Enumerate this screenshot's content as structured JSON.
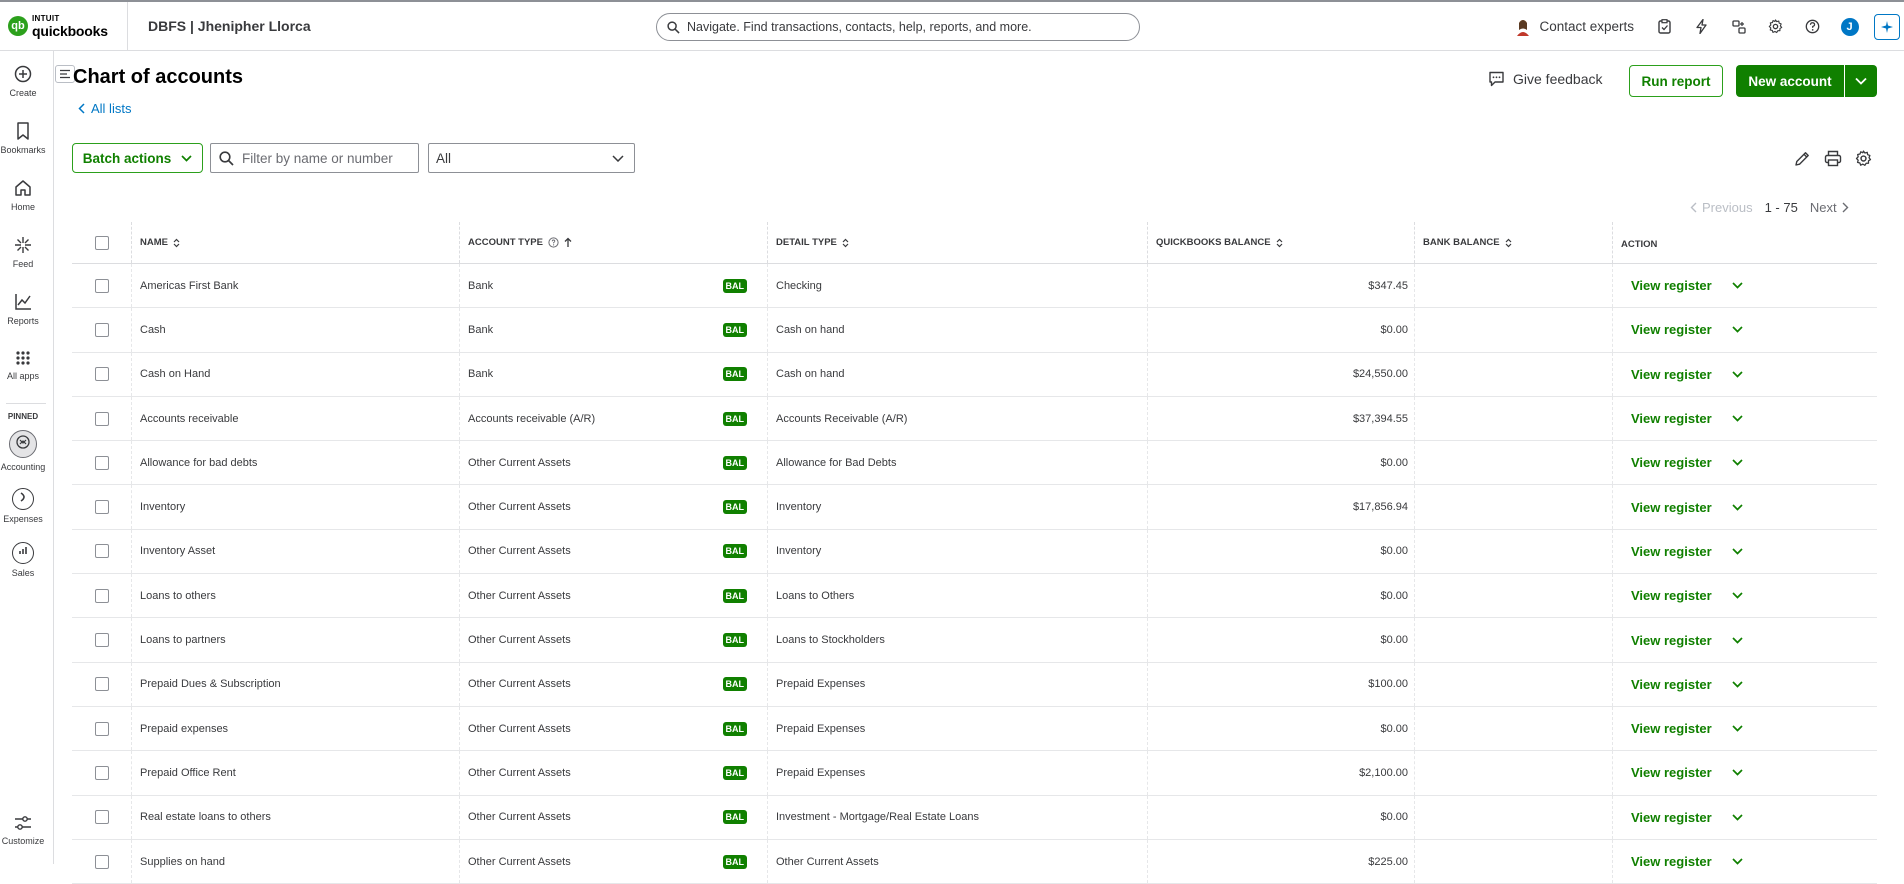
{
  "header": {
    "logo_intuit": "INTUIT",
    "logo_brand": "quickbooks",
    "company": "DBFS | Jhenipher Llorca",
    "search_placeholder": "Navigate. Find transactions, contacts, help, reports, and more.",
    "contact_experts": "Contact experts",
    "user_initial": "J"
  },
  "rail": {
    "create": "Create",
    "bookmarks": "Bookmarks",
    "home": "Home",
    "feed": "Feed",
    "reports": "Reports",
    "all_apps": "All apps",
    "pinned": "PINNED",
    "accounting": "Accounting",
    "expenses": "Expenses",
    "sales": "Sales",
    "customize": "Customize"
  },
  "page": {
    "title": "Chart of accounts",
    "back_link": "All lists",
    "give_feedback": "Give feedback",
    "run_report": "Run report",
    "new_account": "New account",
    "batch_actions": "Batch actions",
    "filter_placeholder": "Filter by name or number",
    "type_filter": "All",
    "pager_prev": "Previous",
    "pager_range": "1 - 75",
    "pager_next": "Next"
  },
  "table": {
    "headers": {
      "name": "NAME",
      "account_type": "ACCOUNT TYPE",
      "detail_type": "DETAIL TYPE",
      "qb_balance": "QUICKBOOKS BALANCE",
      "bank_balance": "BANK BALANCE",
      "action": "ACTION"
    },
    "badge": "BAL",
    "action_label": "View register",
    "rows": [
      {
        "name": "Americas First Bank",
        "type": "Bank",
        "detail": "Checking",
        "balance": "$347.45",
        "bank": ""
      },
      {
        "name": "Cash",
        "type": "Bank",
        "detail": "Cash on hand",
        "balance": "$0.00",
        "bank": ""
      },
      {
        "name": "Cash on Hand",
        "type": "Bank",
        "detail": "Cash on hand",
        "balance": "$24,550.00",
        "bank": ""
      },
      {
        "name": "Accounts receivable",
        "type": "Accounts receivable (A/R)",
        "detail": "Accounts Receivable (A/R)",
        "balance": "$37,394.55",
        "bank": ""
      },
      {
        "name": "Allowance for bad debts",
        "type": "Other Current Assets",
        "detail": "Allowance for Bad Debts",
        "balance": "$0.00",
        "bank": ""
      },
      {
        "name": "Inventory",
        "type": "Other Current Assets",
        "detail": "Inventory",
        "balance": "$17,856.94",
        "bank": ""
      },
      {
        "name": "Inventory Asset",
        "type": "Other Current Assets",
        "detail": "Inventory",
        "balance": "$0.00",
        "bank": ""
      },
      {
        "name": "Loans to others",
        "type": "Other Current Assets",
        "detail": "Loans to Others",
        "balance": "$0.00",
        "bank": ""
      },
      {
        "name": "Loans to partners",
        "type": "Other Current Assets",
        "detail": "Loans to Stockholders",
        "balance": "$0.00",
        "bank": ""
      },
      {
        "name": "Prepaid Dues & Subscription",
        "type": "Other Current Assets",
        "detail": "Prepaid Expenses",
        "balance": "$100.00",
        "bank": ""
      },
      {
        "name": "Prepaid expenses",
        "type": "Other Current Assets",
        "detail": "Prepaid Expenses",
        "balance": "$0.00",
        "bank": ""
      },
      {
        "name": "Prepaid Office Rent",
        "type": "Other Current Assets",
        "detail": "Prepaid Expenses",
        "balance": "$2,100.00",
        "bank": ""
      },
      {
        "name": "Real estate loans to others",
        "type": "Other Current Assets",
        "detail": "Investment - Mortgage/Real Estate Loans",
        "balance": "$0.00",
        "bank": ""
      },
      {
        "name": "Supplies on hand",
        "type": "Other Current Assets",
        "detail": "Other Current Assets",
        "balance": "$225.00",
        "bank": ""
      }
    ]
  }
}
